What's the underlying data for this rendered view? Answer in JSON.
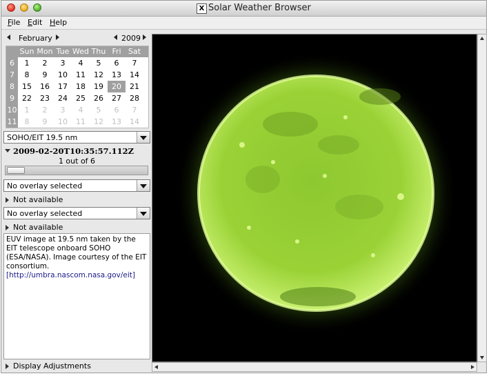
{
  "window": {
    "title": "Solar Weather Browser",
    "x_logo": "X"
  },
  "menubar": {
    "items": [
      {
        "label": "File"
      },
      {
        "label": "Edit"
      },
      {
        "label": "Help"
      }
    ]
  },
  "calendar": {
    "month": "February",
    "year": "2009",
    "weekdays": [
      "Sun",
      "Mon",
      "Tue",
      "Wed",
      "Thu",
      "Fri",
      "Sat"
    ],
    "weeks": [
      "6",
      "7",
      "8",
      "9",
      "10",
      "11"
    ],
    "rows": [
      [
        "1",
        "2",
        "3",
        "4",
        "5",
        "6",
        "7"
      ],
      [
        "8",
        "9",
        "10",
        "11",
        "12",
        "13",
        "14"
      ],
      [
        "15",
        "16",
        "17",
        "18",
        "19",
        "20",
        "21"
      ],
      [
        "22",
        "23",
        "24",
        "25",
        "26",
        "27",
        "28"
      ],
      [
        "1",
        "2",
        "3",
        "4",
        "5",
        "6",
        "7"
      ],
      [
        "8",
        "9",
        "10",
        "11",
        "12",
        "13",
        "14"
      ]
    ],
    "selected_day": "20"
  },
  "instrument_select": {
    "value": "SOHO/EIT 19.5 nm"
  },
  "timestamp": {
    "value": "2009-02-20T10:35:57.112Z"
  },
  "image_counter": {
    "value": "1 out of 6"
  },
  "image_slider": {
    "position_fraction": 0.0
  },
  "overlay1": {
    "value": "No overlay selected",
    "status": "Not available"
  },
  "overlay2": {
    "value": "No overlay selected",
    "status": "Not available"
  },
  "description": {
    "text": "EUV image at 19.5 nm taken by the EIT telescope onboard SOHO (ESA/NASA). Image courtesy of the EIT consortium.",
    "link": "[http://umbra.nascom.nasa.gov/eit]"
  },
  "display_adjustments": {
    "label": "Display Adjustments"
  },
  "colors": {
    "sun": "#9bd636",
    "corona": "#c6f06a",
    "background": "#000000"
  }
}
